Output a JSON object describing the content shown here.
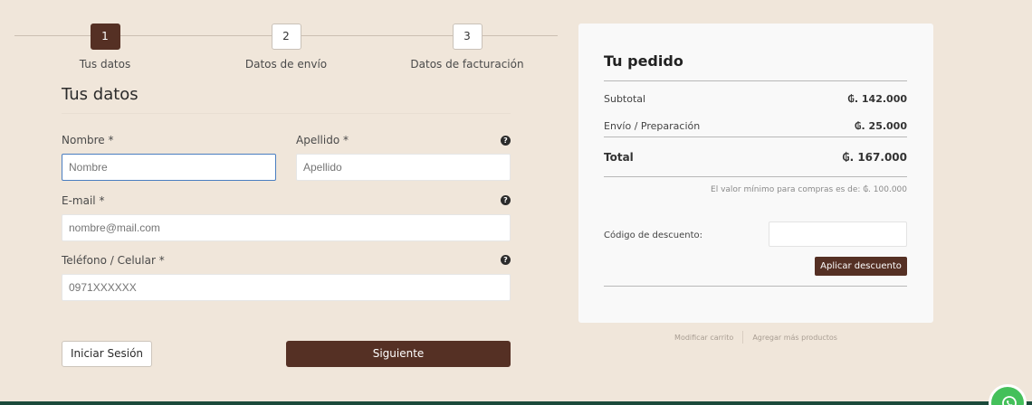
{
  "steps": [
    {
      "num": "1",
      "label": "Tus datos"
    },
    {
      "num": "2",
      "label": "Datos de envío"
    },
    {
      "num": "3",
      "label": "Datos de facturación"
    }
  ],
  "form": {
    "title": "Tus datos",
    "nombre": {
      "label": "Nombre *",
      "placeholder": "Nombre"
    },
    "apellido": {
      "label": "Apellido *",
      "placeholder": "Apellido"
    },
    "email": {
      "label": "E-mail *",
      "placeholder": "nombre@mail.com"
    },
    "telefono": {
      "label": "Teléfono / Celular *",
      "placeholder": "0971XXXXXX"
    },
    "help_glyph": "?",
    "login_label": "Iniciar Sesión",
    "next_label": "Siguiente"
  },
  "order": {
    "title": "Tu pedido",
    "subtotal_label": "Subtotal",
    "subtotal_value": "₲. 142.000",
    "shipping_label": "Envío / Preparación",
    "shipping_value": "₲. 25.000",
    "total_label": "Total",
    "total_value": "₲. 167.000",
    "min_note": "El valor mínimo para compras es de: ₲. 100.000",
    "discount_label": "Código de descuento:",
    "discount_button": "Aplicar descuento"
  },
  "links": {
    "modify_cart": "Modificar carrito",
    "add_products": "Agregar más productos"
  },
  "colors": {
    "accent": "#553024",
    "background": "#f0e6da",
    "whatsapp": "#44c05a",
    "footer": "#1b4a3b"
  }
}
